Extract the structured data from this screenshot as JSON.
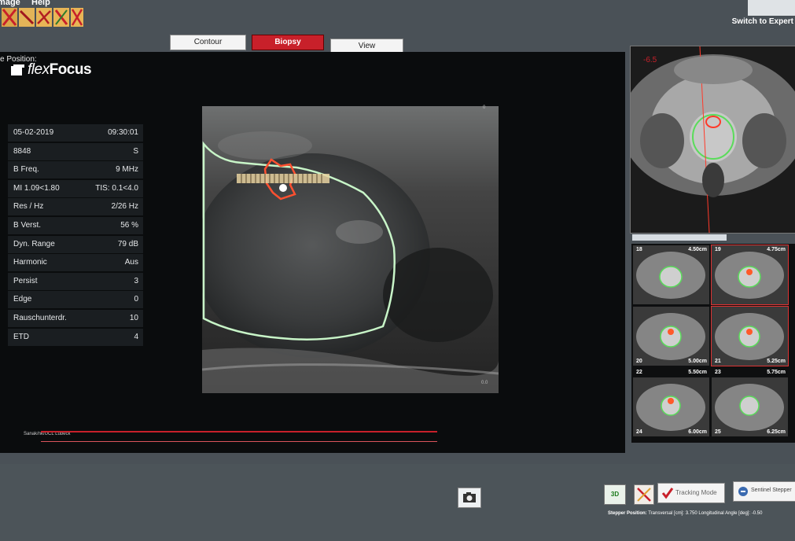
{
  "menu": {
    "items": [
      "Image",
      "Help"
    ]
  },
  "toolbar": {
    "switch_label": "Switch to Expert"
  },
  "mode_tabs": [
    {
      "label": "Contour",
      "active": false
    },
    {
      "label": "Biopsy",
      "active": true
    },
    {
      "label": "View",
      "active": false
    }
  ],
  "position_label": "e Position:",
  "brand": {
    "name_part1": "flex",
    "name_part2": "Focus"
  },
  "params": [
    {
      "key": "05-02-2019",
      "value": "09:30:01"
    },
    {
      "key": "8848",
      "value": "S"
    },
    {
      "key": "B Freq.",
      "value": "9 MHz"
    },
    {
      "key": "MI 1.09<1.80",
      "value": "TIS: 0.1<4.0"
    },
    {
      "key": "Res / Hz",
      "value": "2/26 Hz"
    },
    {
      "key": "B Verst.",
      "value": "56 %"
    },
    {
      "key": "Dyn. Range",
      "value": "79 dB"
    },
    {
      "key": "Harmonic",
      "value": "Aus"
    },
    {
      "key": "Persist",
      "value": "3"
    },
    {
      "key": "Edge",
      "value": "0"
    },
    {
      "key": "Rauschunterdr.",
      "value": "10"
    },
    {
      "key": "ETD",
      "value": "4"
    }
  ],
  "us_scale": {
    "top": "0",
    "bottom": "0.0"
  },
  "caption": "Sanak/nk/UCL Lubeck",
  "mri_top_label": "-6.5",
  "grid": [
    {
      "index": "18",
      "dist": "4.50cm"
    },
    {
      "index": "19",
      "dist": "4.75cm"
    },
    {
      "index": "20",
      "dist": "5.00cm"
    },
    {
      "index": "21",
      "dist": "5.25cm"
    },
    {
      "index": "22",
      "dist": "5.50cm"
    },
    {
      "index": "23",
      "dist": "5.75cm"
    },
    {
      "index": "24",
      "dist": "6.00cm"
    },
    {
      "index": "25",
      "dist": "6.25cm"
    }
  ],
  "buttons": {
    "three_d": "3D",
    "tracking_mode": "Tracking Mode",
    "sentinel": "Sentinel Stepper"
  },
  "stepper": {
    "label": "Stepper Position:",
    "transversal_label": "Transversal [cm]:",
    "transversal_value": "3.750",
    "angle_label": "Longitudinal Angle [deg]:",
    "angle_value": "-0.50"
  },
  "colors": {
    "accent": "#c8202a",
    "contour": "#b8f0b8",
    "background": "#4a5157"
  }
}
